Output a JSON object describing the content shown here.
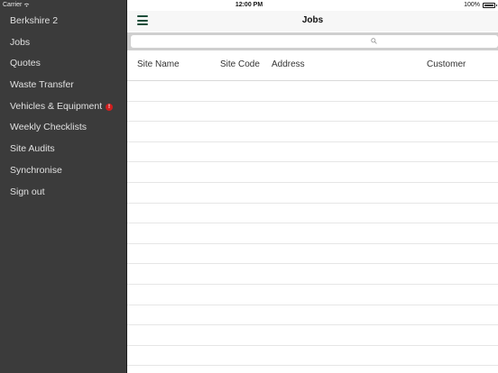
{
  "status_bar": {
    "carrier": "Carrier",
    "time": "12:00 PM",
    "battery": "100%"
  },
  "sidebar": {
    "items": [
      {
        "label": "Berkshire 2"
      },
      {
        "label": "Jobs"
      },
      {
        "label": "Quotes"
      },
      {
        "label": "Waste Transfer"
      },
      {
        "label": "Vehicles & Equipment",
        "badge": "!"
      },
      {
        "label": "Weekly Checklists"
      },
      {
        "label": "Site Audits"
      },
      {
        "label": "Synchronise"
      },
      {
        "label": "Sign out"
      }
    ]
  },
  "header": {
    "title": "Jobs",
    "menu_icon": "hamburger-icon"
  },
  "search": {
    "placeholder": "",
    "icon": "search-icon"
  },
  "table": {
    "columns": [
      "Site Name",
      "Site Code",
      "Address",
      "Customer"
    ],
    "rows": []
  },
  "colors": {
    "sidebar_bg": "#3b3b3b",
    "accent": "#1e4d3a",
    "badge": "#d01e1e"
  }
}
